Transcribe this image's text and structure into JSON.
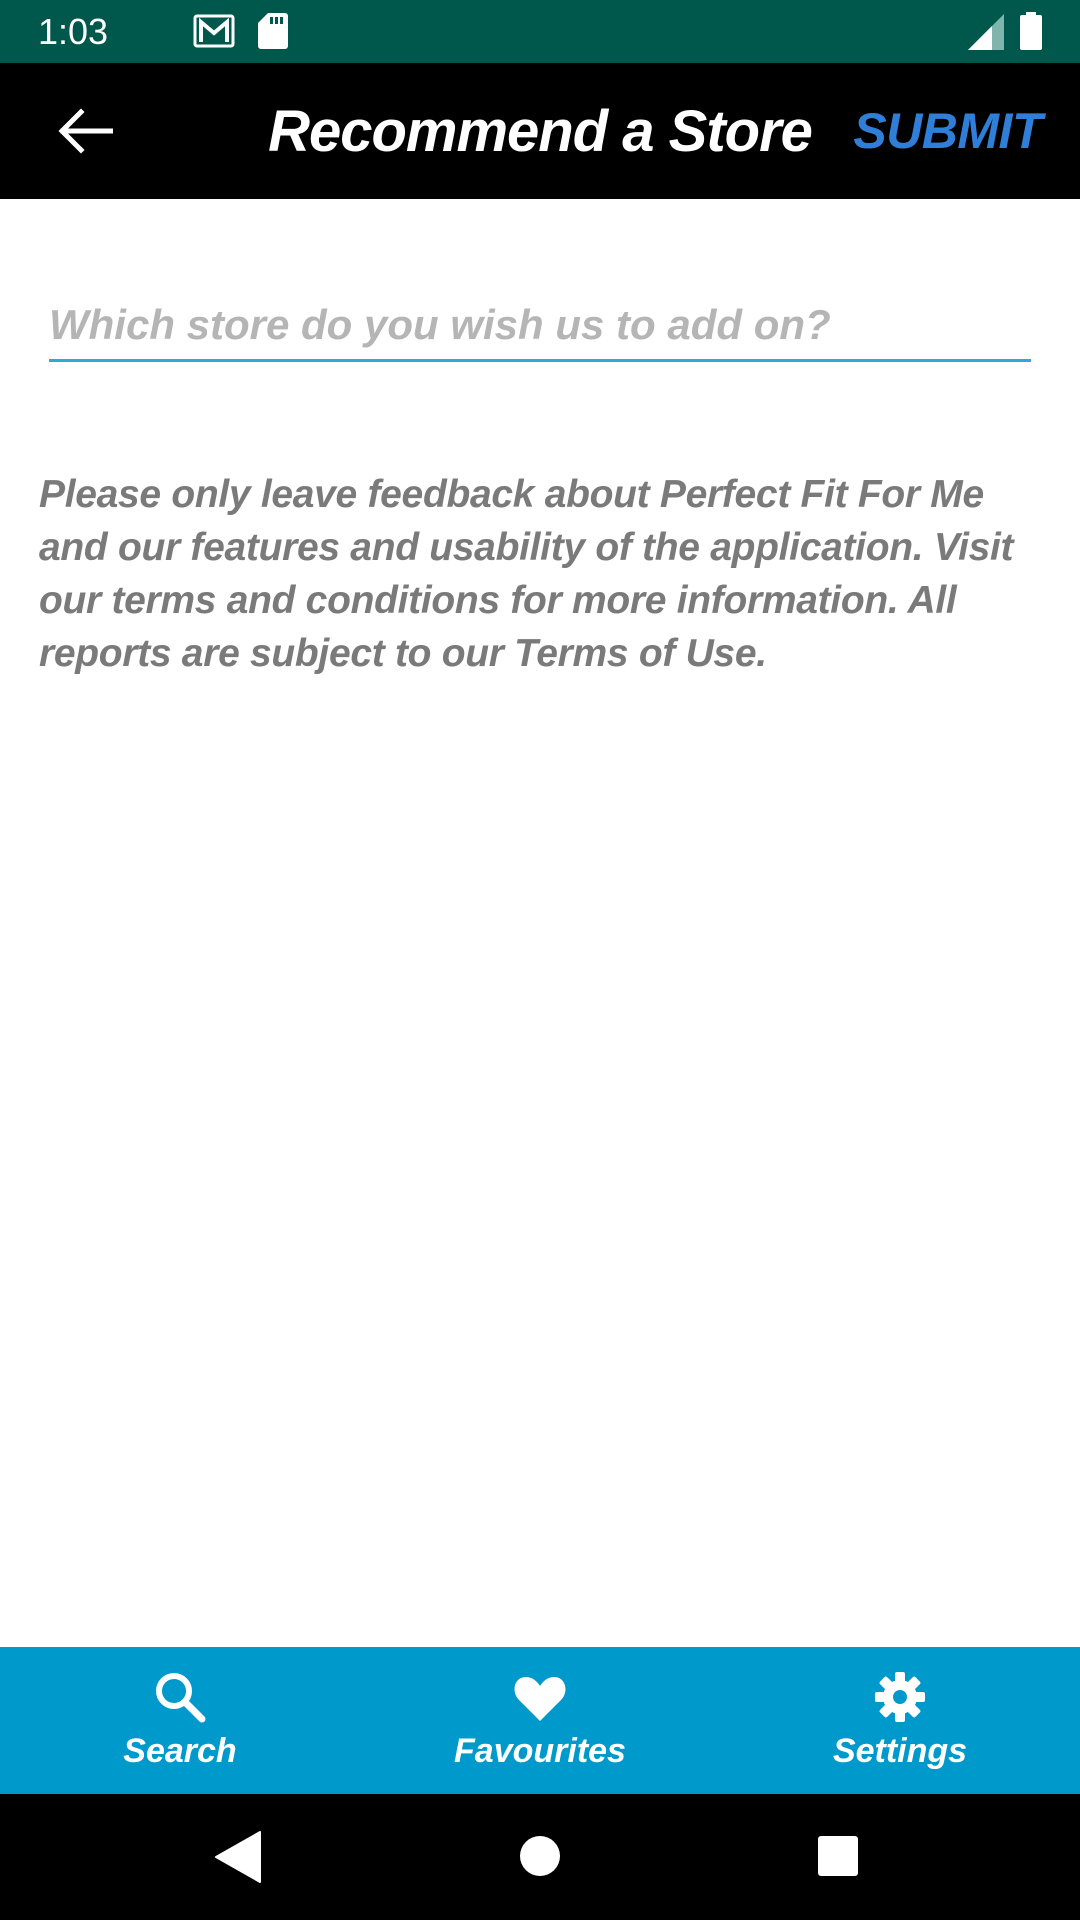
{
  "status_bar": {
    "time": "1:03",
    "icons": [
      "gmail-icon",
      "sd-card-icon",
      "signal-icon",
      "battery-icon"
    ],
    "background": "#00574b"
  },
  "app_bar": {
    "title": "Recommend a Store",
    "submit_label": "SUBMIT",
    "back_icon": "arrow-left-icon",
    "accent": "#2f7fd8"
  },
  "form": {
    "store_field": {
      "value": "",
      "placeholder": "Which store do you wish us to add on?"
    },
    "notice": "Please only leave feedback about Perfect Fit For Me and our features and usability of the application. Visit our terms and conditions for more information. All reports are subject to our Terms of Use."
  },
  "bottom_nav": {
    "background": "#0099cc",
    "items": [
      {
        "label": "Search",
        "icon": "search-icon"
      },
      {
        "label": "Favourites",
        "icon": "heart-icon"
      },
      {
        "label": "Settings",
        "icon": "gear-icon"
      }
    ]
  },
  "system_nav": {
    "icons": [
      "back-triangle-icon",
      "home-circle-icon",
      "recents-square-icon"
    ]
  }
}
